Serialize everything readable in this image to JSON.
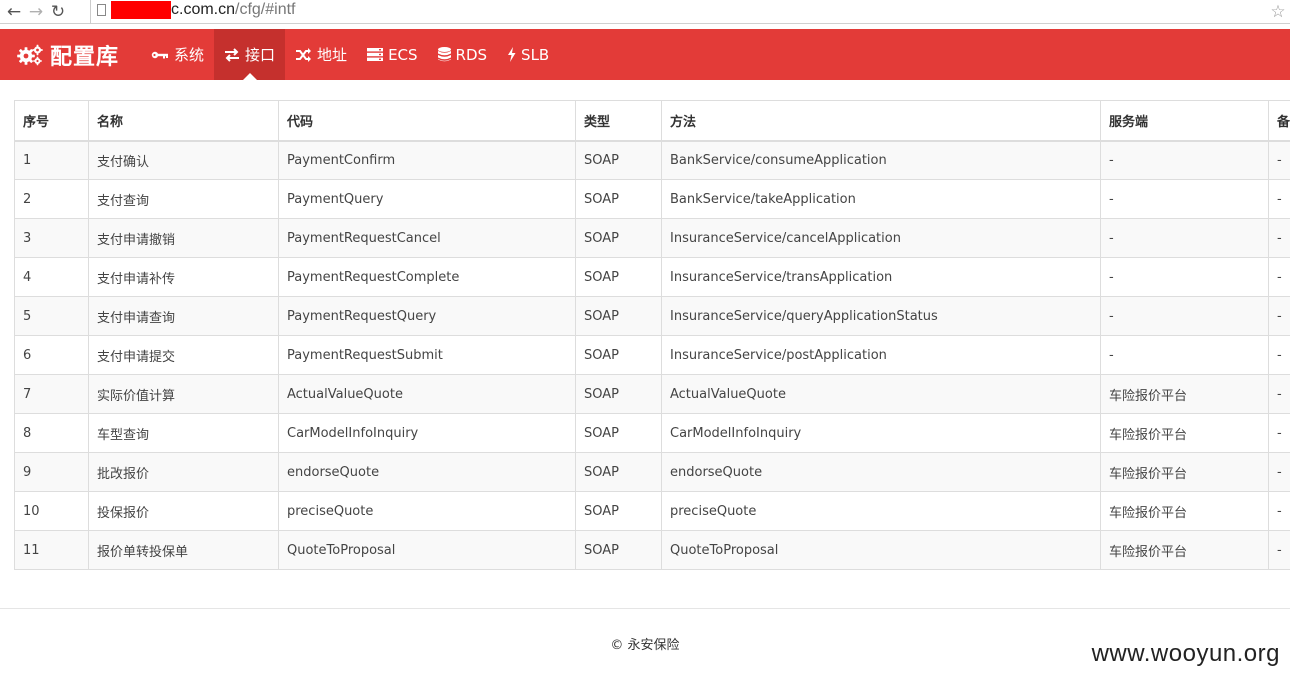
{
  "browser": {
    "url_host": "c.com.cn",
    "url_path": "/cfg/#intf",
    "back_icon": "arrow-left",
    "forward_icon": "arrow-right",
    "reload_icon": "reload",
    "star_icon": "star"
  },
  "navbar": {
    "brand": "配置库",
    "color": "#e33b38",
    "active_color": "#c5302d",
    "items": [
      {
        "label": "系统",
        "icon": "key-icon"
      },
      {
        "label": "接口",
        "icon": "exchange-icon",
        "active": true
      },
      {
        "label": "地址",
        "icon": "shuffle-icon"
      },
      {
        "label": "ECS",
        "icon": "server-icon"
      },
      {
        "label": "RDS",
        "icon": "database-icon"
      },
      {
        "label": "SLB",
        "icon": "bolt-icon"
      }
    ]
  },
  "table": {
    "headers": [
      "序号",
      "名称",
      "代码",
      "类型",
      "方法",
      "服务端",
      "备"
    ],
    "rows": [
      [
        "1",
        "支付确认",
        "PaymentConfirm",
        "SOAP",
        "BankService/consumeApplication",
        "-",
        "-"
      ],
      [
        "2",
        "支付查询",
        "PaymentQuery",
        "SOAP",
        "BankService/takeApplication",
        "-",
        "-"
      ],
      [
        "3",
        "支付申请撤销",
        "PaymentRequestCancel",
        "SOAP",
        "InsuranceService/cancelApplication",
        "-",
        "-"
      ],
      [
        "4",
        "支付申请补传",
        "PaymentRequestComplete",
        "SOAP",
        "InsuranceService/transApplication",
        "-",
        "-"
      ],
      [
        "5",
        "支付申请查询",
        "PaymentRequestQuery",
        "SOAP",
        "InsuranceService/queryApplicationStatus",
        "-",
        "-"
      ],
      [
        "6",
        "支付申请提交",
        "PaymentRequestSubmit",
        "SOAP",
        "InsuranceService/postApplication",
        "-",
        "-"
      ],
      [
        "7",
        "实际价值计算",
        "ActualValueQuote",
        "SOAP",
        "ActualValueQuote",
        "车险报价平台",
        "-"
      ],
      [
        "8",
        "车型查询",
        "CarModelInfoInquiry",
        "SOAP",
        "CarModelInfoInquiry",
        "车险报价平台",
        "-"
      ],
      [
        "9",
        "批改报价",
        "endorseQuote",
        "SOAP",
        "endorseQuote",
        "车险报价平台",
        "-"
      ],
      [
        "10",
        "投保报价",
        "preciseQuote",
        "SOAP",
        "preciseQuote",
        "车险报价平台",
        "-"
      ],
      [
        "11",
        "报价单转投保单",
        "QuoteToProposal",
        "SOAP",
        "QuoteToProposal",
        "车险报价平台",
        "-"
      ]
    ]
  },
  "footer": {
    "text": "© 永安保险"
  },
  "watermark": "www.wooyun.org"
}
